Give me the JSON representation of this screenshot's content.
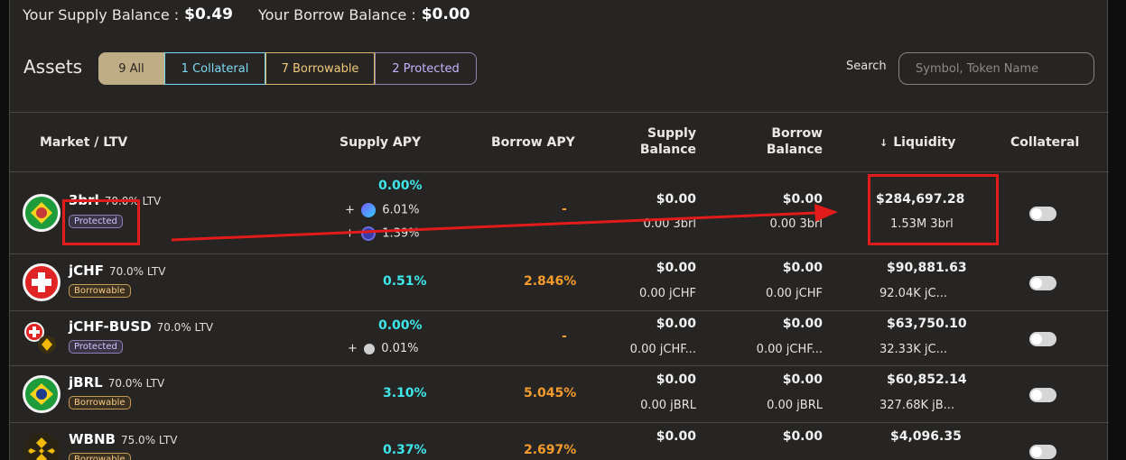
{
  "balances": {
    "supply_label": "Your Supply Balance :",
    "supply_value": "$0.49",
    "borrow_label": "Your Borrow Balance :",
    "borrow_value": "$0.00"
  },
  "assets": {
    "title": "Assets",
    "filters": [
      "9 All",
      "1 Collateral",
      "7 Borrowable",
      "2 Protected"
    ]
  },
  "search": {
    "label": "Search",
    "placeholder": "Symbol, Token Name"
  },
  "columns": {
    "market": "Market / LTV",
    "supply_apy": "Supply APY",
    "borrow_apy": "Borrow APY",
    "supply_balance_1": "Supply",
    "supply_balance_2": "Balance",
    "borrow_balance_1": "Borrow",
    "borrow_balance_2": "Balance",
    "sort_arrow": "↓",
    "liquidity": "Liquidity",
    "collateral": "Collateral"
  },
  "rows": [
    {
      "symbol": "3brl",
      "ltv": "70.0% LTV",
      "badge": "Protected",
      "supply_apy": "0.00%",
      "reward1_prefix": "+",
      "reward1": "6.01%",
      "reward2_prefix": "+",
      "reward2": "1.39%",
      "borrow_apy": "-",
      "supply_usd": "$0.00",
      "supply_amt": "0.00 3brl",
      "borrow_usd": "$0.00",
      "borrow_amt": "0.00 3brl",
      "liq_usd": "$284,697.28",
      "liq_amt": "1.53M 3brl"
    },
    {
      "symbol": "jCHF",
      "ltv": "70.0% LTV",
      "badge": "Borrowable",
      "supply_apy": "0.51%",
      "borrow_apy": "2.846%",
      "supply_usd": "$0.00",
      "supply_amt": "0.00 jCHF",
      "borrow_usd": "$0.00",
      "borrow_amt": "0.00 jCHF",
      "liq_usd": "$90,881.63",
      "liq_amt": "92.04K jC..."
    },
    {
      "symbol": "jCHF-BUSD",
      "ltv": "70.0% LTV",
      "badge": "Protected",
      "supply_apy": "0.00%",
      "reward1_prefix": "+",
      "reward1": "0.01%",
      "borrow_apy": "-",
      "supply_usd": "$0.00",
      "supply_amt": "0.00 jCHF...",
      "borrow_usd": "$0.00",
      "borrow_amt": "0.00 jCHF...",
      "liq_usd": "$63,750.10",
      "liq_amt": "32.33K jC..."
    },
    {
      "symbol": "jBRL",
      "ltv": "70.0% LTV",
      "badge": "Borrowable",
      "supply_apy": "3.10%",
      "borrow_apy": "5.045%",
      "supply_usd": "$0.00",
      "supply_amt": "0.00 jBRL",
      "borrow_usd": "$0.00",
      "borrow_amt": "0.00 jBRL",
      "liq_usd": "$60,852.14",
      "liq_amt": "327.68K jB..."
    },
    {
      "symbol": "WBNB",
      "ltv": "75.0% LTV",
      "badge": "Borrowable",
      "supply_apy": "0.37%",
      "borrow_apy": "2.697%",
      "supply_usd": "$0.00",
      "borrow_usd": "$0.00",
      "liq_usd": "$4,096.35"
    }
  ],
  "colors": {
    "accent_cyan": "#3ee6ea",
    "accent_orange": "#f39b2d",
    "annotation_red": "#e21b1b"
  }
}
